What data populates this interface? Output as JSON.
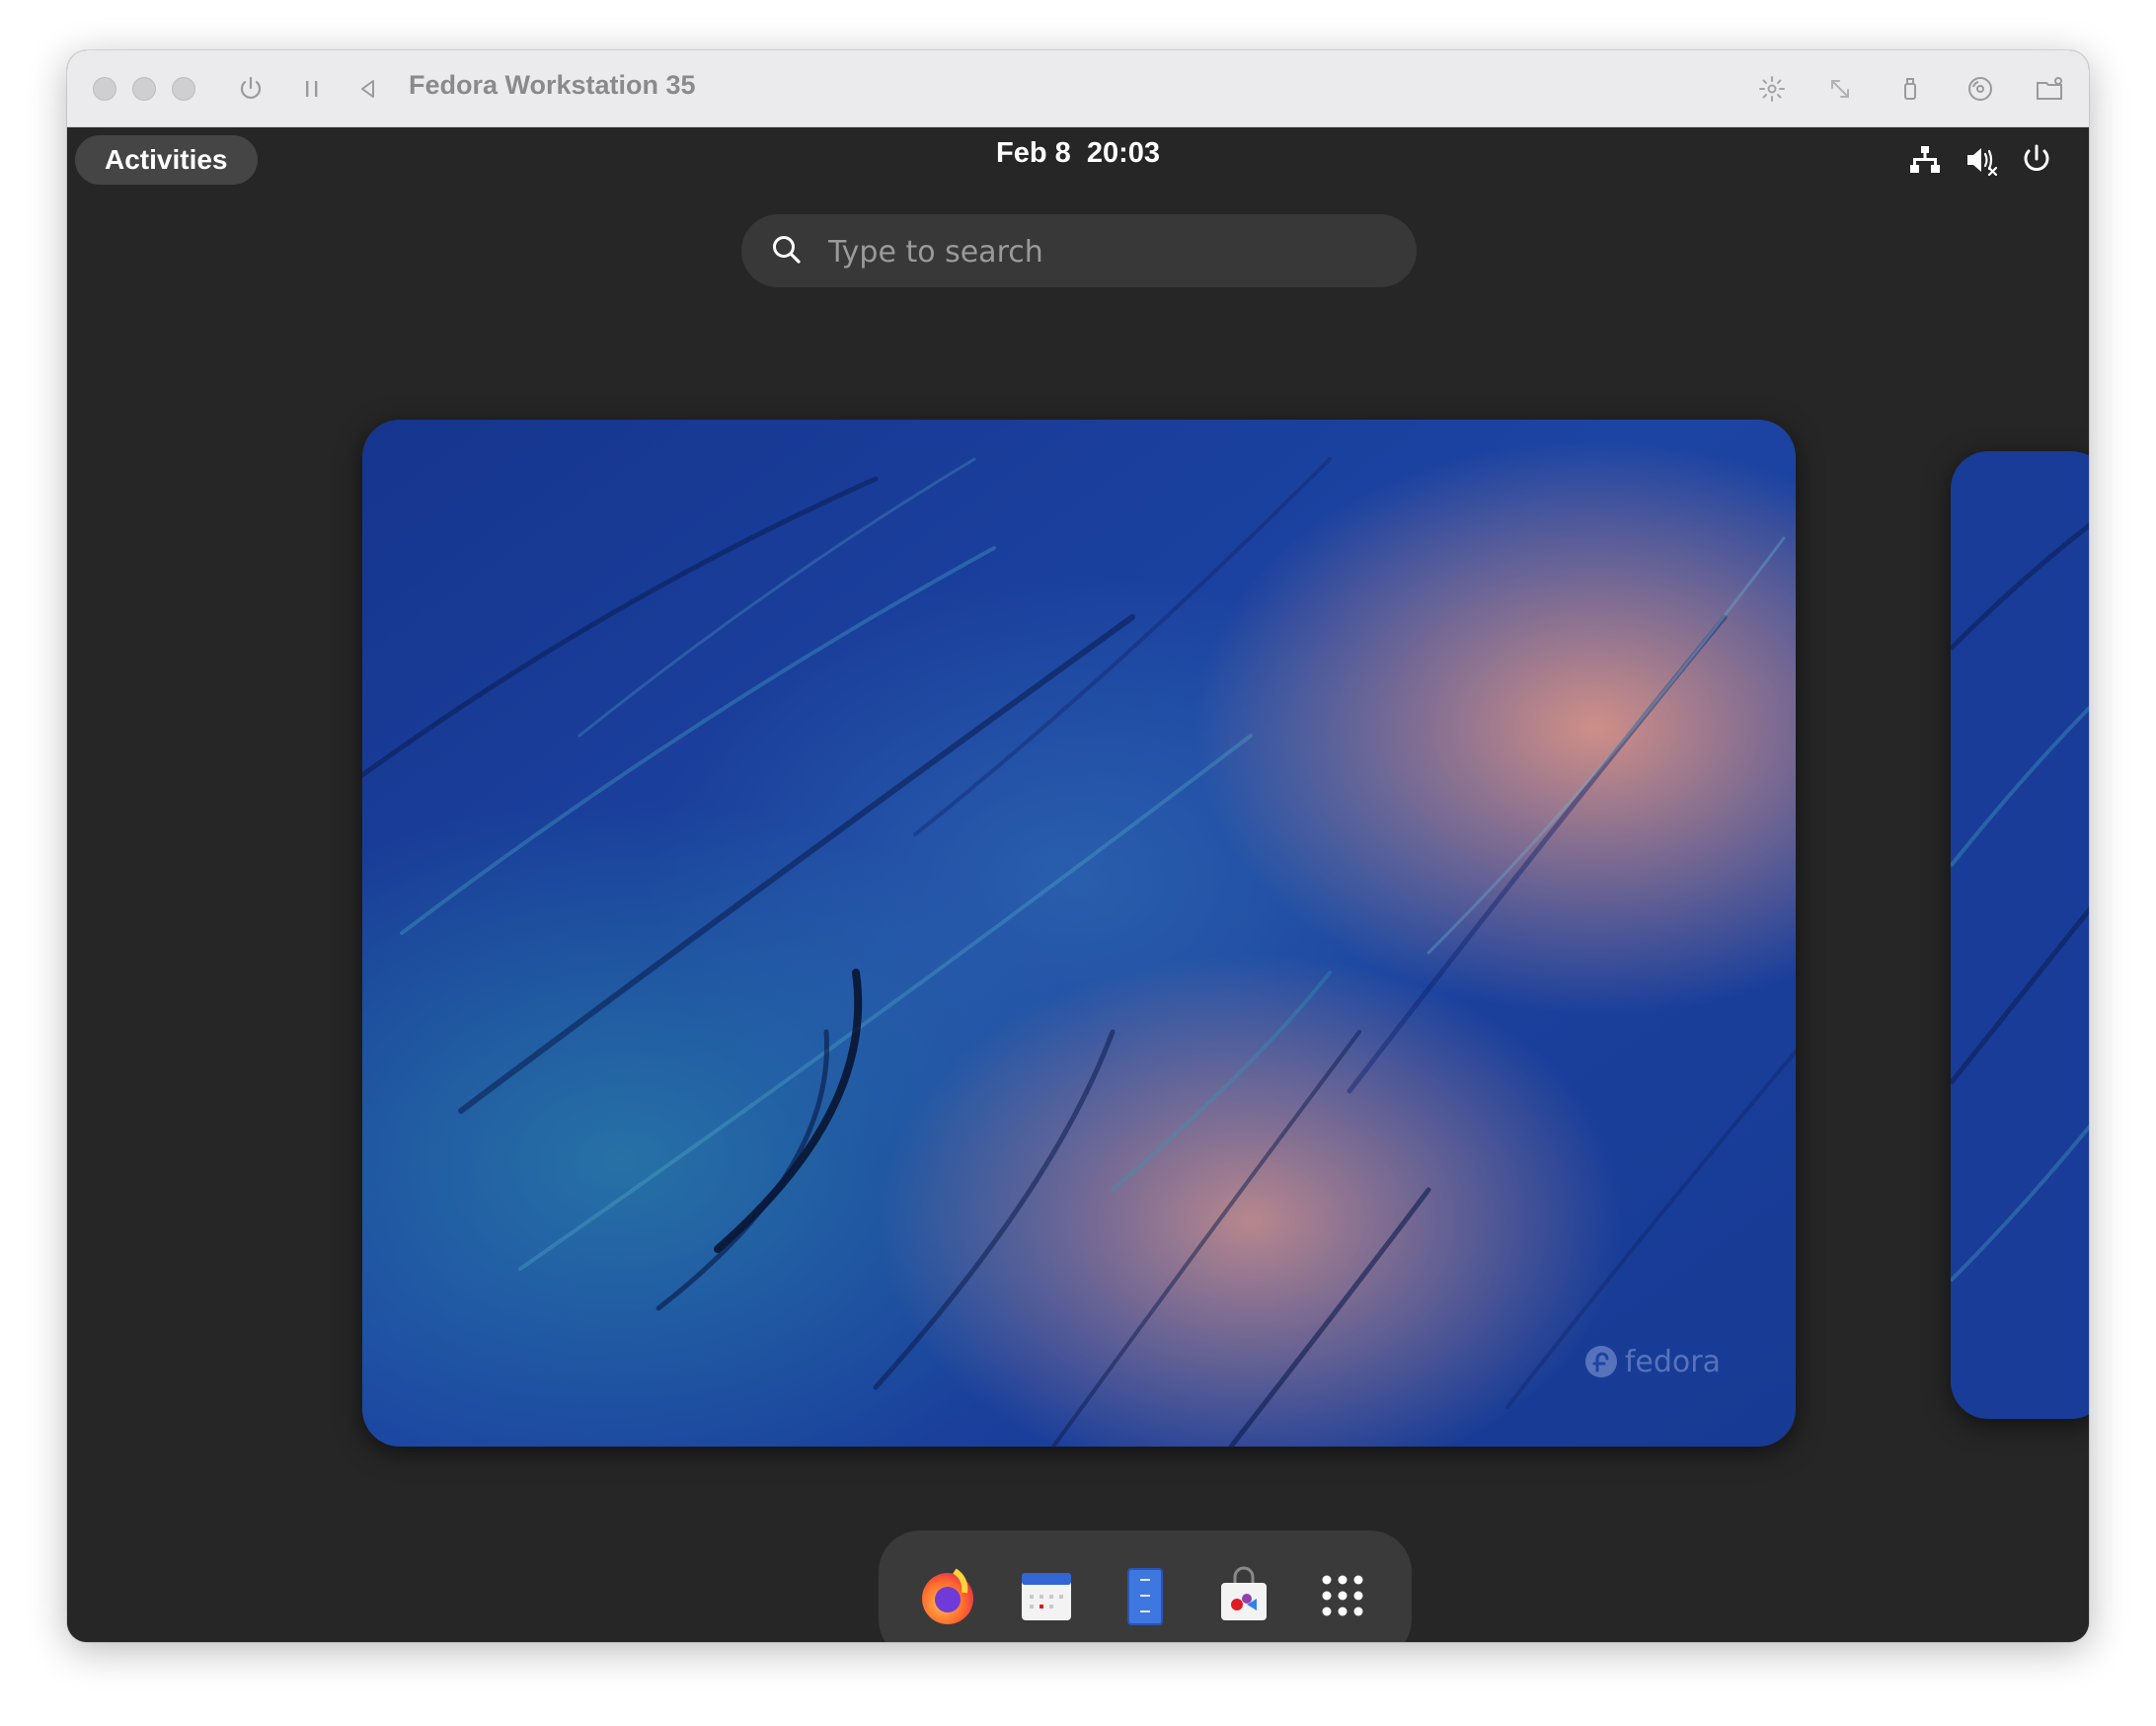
{
  "vm_window": {
    "title": "Fedora Workstation 35"
  },
  "gnome": {
    "activities_label": "Activities",
    "clock": "Feb 8  20:03",
    "search": {
      "placeholder": "Type to search",
      "value": ""
    },
    "system_indicators": [
      "network-wired-icon",
      "volume-muted-icon",
      "power-icon"
    ],
    "wallpaper_watermark": "fedora",
    "dash": [
      "firefox-icon",
      "calendar-icon",
      "files-icon",
      "software-icon",
      "show-apps-icon"
    ]
  },
  "colors": {
    "panel_bg": "#262626",
    "search_bg": "#383838",
    "dash_bg": "#3a3a3a",
    "wallpaper_blue": "#1b3f9a",
    "wallpaper_peach": "#d08c85"
  }
}
